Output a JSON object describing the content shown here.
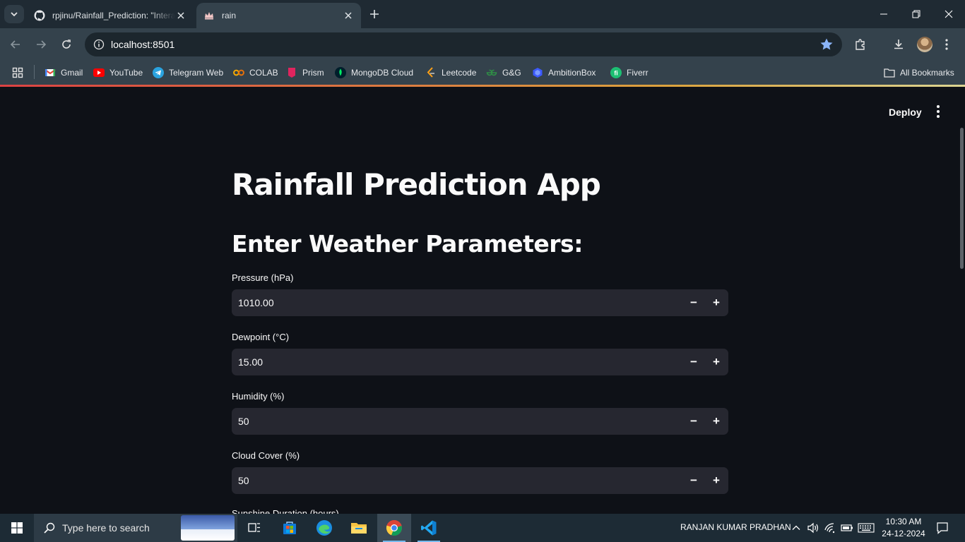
{
  "browser": {
    "tabs": [
      {
        "title": "rpjinu/Rainfall_Prediction: \"Interactive Rainfall Prediction",
        "icon": "github-icon",
        "active": false
      },
      {
        "title": "rain",
        "icon": "streamlit-crown-icon",
        "active": true
      }
    ],
    "address": "localhost:8501",
    "bookmarks": [
      {
        "label": "Gmail",
        "icon": "gmail-icon"
      },
      {
        "label": "YouTube",
        "icon": "youtube-icon"
      },
      {
        "label": "Telegram Web",
        "icon": "telegram-icon"
      },
      {
        "label": "COLAB",
        "icon": "colab-icon"
      },
      {
        "label": "Prism",
        "icon": "prism-icon"
      },
      {
        "label": "MongoDB Cloud",
        "icon": "mongodb-icon"
      },
      {
        "label": "Leetcode",
        "icon": "leetcode-icon"
      },
      {
        "label": "G&G",
        "icon": "gfg-icon"
      },
      {
        "label": "AmbitionBox",
        "icon": "ambitionbox-icon"
      },
      {
        "label": "Fiverr",
        "icon": "fiverr-icon"
      }
    ],
    "all_bookmarks": "All Bookmarks"
  },
  "app": {
    "deploy_label": "Deploy",
    "title": "Rainfall Prediction App",
    "subtitle": "Enter Weather Parameters:",
    "fields": [
      {
        "label": "Pressure (hPa)",
        "value": "1010.00"
      },
      {
        "label": "Dewpoint (°C)",
        "value": "15.00"
      },
      {
        "label": "Humidity (%)",
        "value": "50"
      },
      {
        "label": "Cloud Cover (%)",
        "value": "50"
      },
      {
        "label": "Sunshine Duration (hours)",
        "value": ""
      }
    ],
    "stepper": {
      "minus": "−",
      "plus": "+"
    },
    "colors": {
      "background": "#0e1117",
      "input_bg": "#262730",
      "text": "#fafafa"
    }
  },
  "taskbar": {
    "search_placeholder": "Type here to search",
    "user_name": "RANJAN KUMAR PRADHAN",
    "time": "10:30 AM",
    "date": "24-12-2024"
  }
}
